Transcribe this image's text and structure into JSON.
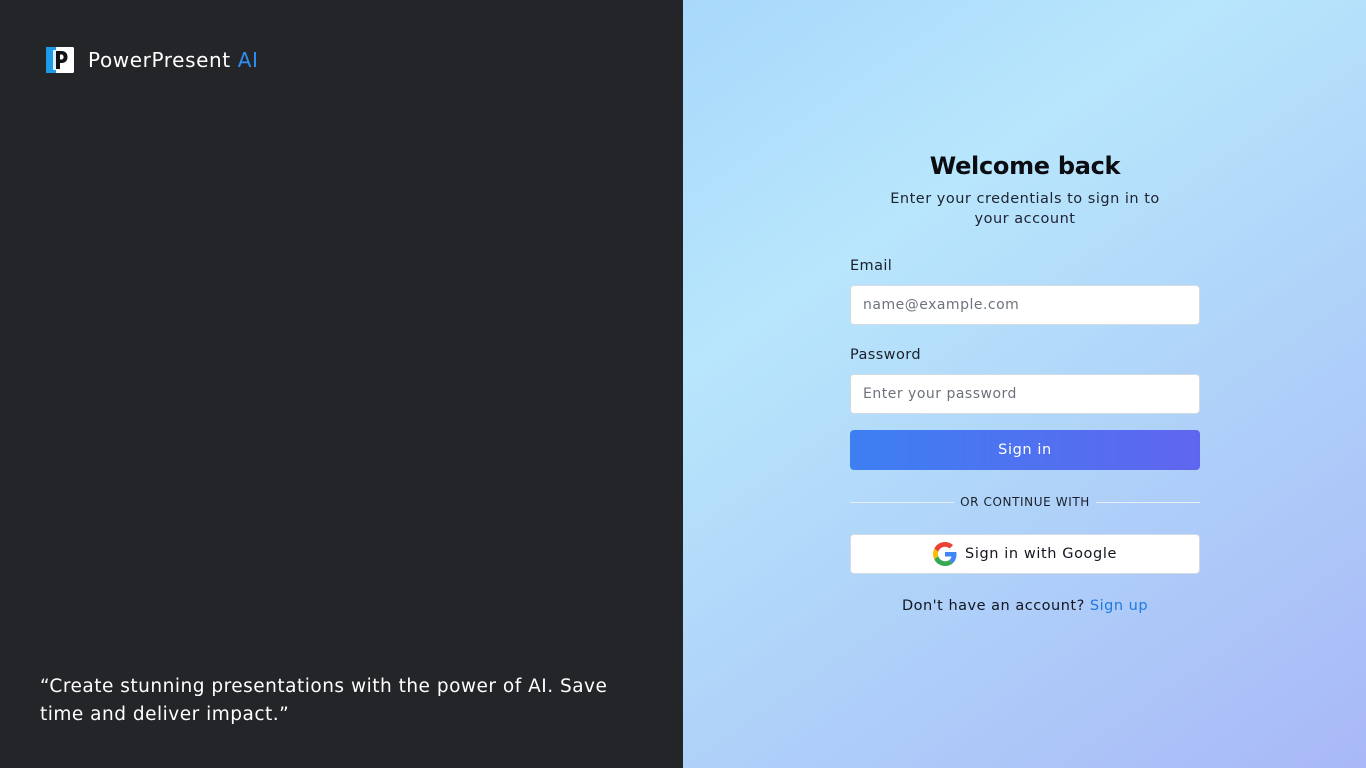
{
  "brand": {
    "name": "PowerPresent",
    "accent": "AI",
    "logo_icon": "powerpresent-logo-icon",
    "accent_color": "#2f8ff0"
  },
  "quote": {
    "text": "“Create stunning presentations with the power of AI. Save time and deliver impact.”"
  },
  "login": {
    "title": "Welcome back",
    "subtitle": "Enter your credentials to sign in to your account",
    "email": {
      "label": "Email",
      "placeholder": "name@example.com",
      "value": ""
    },
    "password": {
      "label": "Password",
      "placeholder": "Enter your password",
      "value": ""
    },
    "signin_label": "Sign in",
    "divider_text": "OR CONTINUE WITH",
    "google": {
      "label": "Sign in with Google",
      "icon": "google-icon"
    },
    "signup_prompt": "Don't have an account?",
    "signup_link": "Sign up"
  },
  "colors": {
    "left_panel_bg": "#242529",
    "button_gradient_start": "#3d7ff2",
    "button_gradient_end": "#6065ef",
    "link": "#1f7ae0"
  }
}
